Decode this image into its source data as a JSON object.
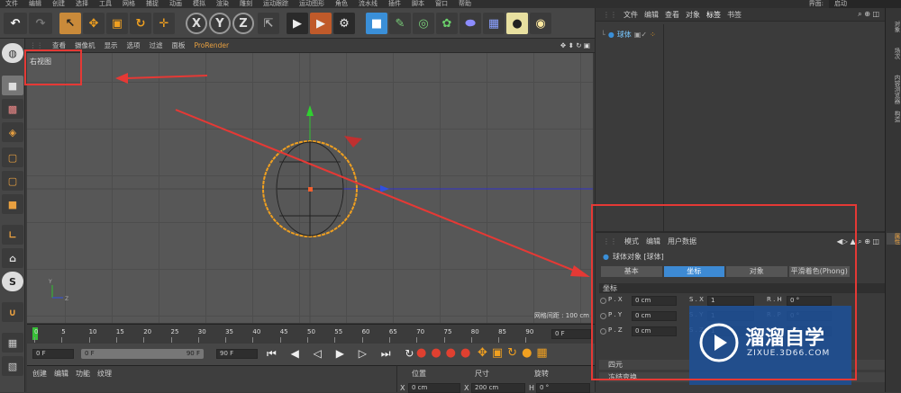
{
  "menubar": [
    "文件",
    "编辑",
    "创建",
    "选择",
    "工具",
    "网格",
    "捕捉",
    "动画",
    "模拟",
    "渲染",
    "雕刻",
    "运动跟踪",
    "运动图形",
    "角色",
    "流水线",
    "插件",
    "脚本",
    "窗口",
    "帮助"
  ],
  "layout_label": "界面:",
  "layout_value": "启动",
  "viewport": {
    "menu": [
      "查看",
      "摄像机",
      "显示",
      "选项",
      "过滤",
      "面板",
      "ProRender"
    ],
    "name": "右视图",
    "grid_info": "网格间距 : 100 cm"
  },
  "timeline": {
    "ticks": [
      "0",
      "5",
      "10",
      "15",
      "20",
      "25",
      "30",
      "35",
      "40",
      "45",
      "50",
      "55",
      "60",
      "65",
      "70",
      "75",
      "80",
      "85",
      "90"
    ],
    "frame_field": "0 F"
  },
  "playbar": {
    "start": "0 F",
    "range_start": "0 F",
    "range_end": "90 F",
    "end": "90 F"
  },
  "bottom_menu": [
    "创建",
    "编辑",
    "功能",
    "纹理"
  ],
  "coord": {
    "headers": [
      "位置",
      "尺寸",
      "旋转"
    ],
    "x_label": "X",
    "x_pos": "0 cm",
    "x_size": "200 cm",
    "h_label": "H",
    "h_rot": "0 °"
  },
  "objects": {
    "menu": [
      "文件",
      "编辑",
      "查看",
      "对象",
      "标签",
      "书签"
    ],
    "item": "球体"
  },
  "attrs": {
    "menu": [
      "模式",
      "编辑",
      "用户数据"
    ],
    "title": "球体对象 [球体]",
    "tabs": [
      "基本",
      "坐标",
      "对象",
      "平滑着色(Phong)"
    ],
    "section": "坐标",
    "rows": [
      {
        "label": "P . X",
        "value": "0 cm",
        "label2": "S . X",
        "value2": "1",
        "label3": "R . H",
        "value3": "0 °"
      },
      {
        "label": "P . Y",
        "value": "0 cm",
        "label2": "S . Y",
        "value2": "1",
        "label3": "R . P",
        "value3": "0 °"
      },
      {
        "label": "P . Z",
        "value": "0 cm",
        "label2": "S . Z",
        "value2": "1",
        "label3": "R . B",
        "value3": "0 °"
      }
    ],
    "sections": [
      "四元",
      "冻结变换"
    ]
  },
  "side_tabs": [
    "对象",
    "场次",
    "内容浏览器",
    "构造",
    "属性"
  ],
  "watermark": {
    "brand": "溜溜自学",
    "url": "ZIXUE.3D66.COM"
  },
  "colors": {
    "accent": "#2e7bc4",
    "annotation": "#e53935",
    "select": "#f0a020"
  }
}
